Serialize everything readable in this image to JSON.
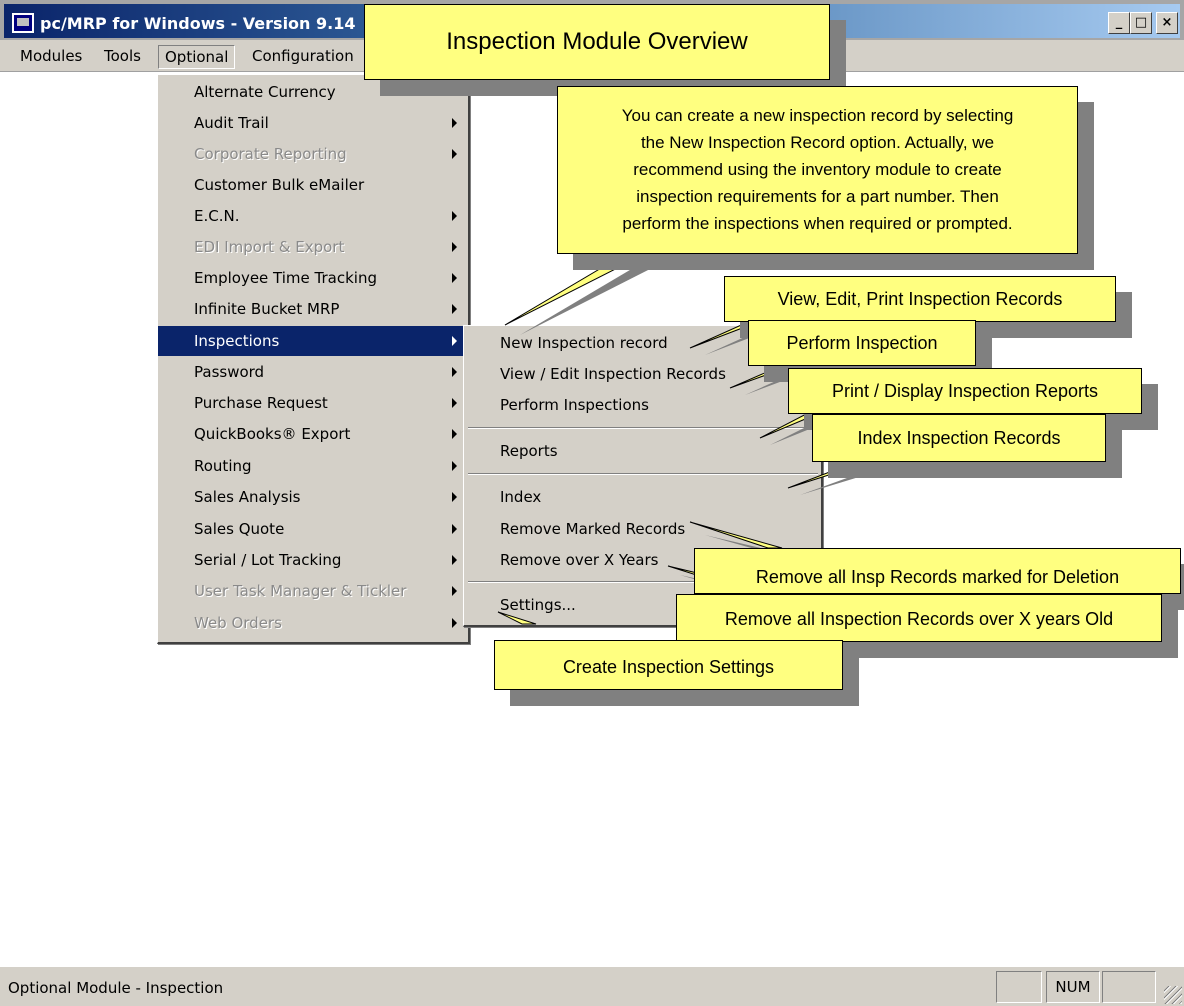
{
  "window": {
    "title": "pc/MRP for Windows - Version 9.14",
    "minimize_glyph": "_",
    "maximize_glyph": "□",
    "close_glyph": "×"
  },
  "menubar": {
    "items": [
      "Modules",
      "Tools",
      "Optional",
      "Configuration"
    ]
  },
  "optional_menu": {
    "items": [
      {
        "label": "Alternate Currency",
        "enabled": true,
        "submenu": false
      },
      {
        "label": "Audit Trail",
        "enabled": true,
        "submenu": true
      },
      {
        "label": "Corporate Reporting",
        "enabled": false,
        "submenu": true
      },
      {
        "label": "Customer Bulk eMailer",
        "enabled": true,
        "submenu": false
      },
      {
        "label": "E.C.N.",
        "enabled": true,
        "submenu": true
      },
      {
        "label": "EDI Import & Export",
        "enabled": false,
        "submenu": true
      },
      {
        "label": "Employee Time Tracking",
        "enabled": true,
        "submenu": true
      },
      {
        "label": "Infinite Bucket MRP",
        "enabled": true,
        "submenu": true
      },
      {
        "label": "Inspections",
        "enabled": true,
        "submenu": true,
        "highlighted": true
      },
      {
        "label": "Password",
        "enabled": true,
        "submenu": true
      },
      {
        "label": "Purchase Request",
        "enabled": true,
        "submenu": true
      },
      {
        "label": "QuickBooks® Export",
        "enabled": true,
        "submenu": true
      },
      {
        "label": "Routing",
        "enabled": true,
        "submenu": true
      },
      {
        "label": "Sales Analysis",
        "enabled": true,
        "submenu": true
      },
      {
        "label": "Sales Quote",
        "enabled": true,
        "submenu": true
      },
      {
        "label": "Serial / Lot Tracking",
        "enabled": true,
        "submenu": true
      },
      {
        "label": "User Task Manager & Tickler",
        "enabled": false,
        "submenu": true
      },
      {
        "label": "Web Orders",
        "enabled": false,
        "submenu": true
      }
    ]
  },
  "inspections_submenu": {
    "items": [
      {
        "label": "New Inspection record"
      },
      {
        "label": "View / Edit Inspection Records"
      },
      {
        "label": "Perform Inspections"
      },
      {
        "label": "Reports"
      },
      {
        "label": "Index"
      },
      {
        "label": "Remove Marked Records"
      },
      {
        "label": "Remove over X Years"
      },
      {
        "label": "Settings..."
      }
    ]
  },
  "callouts": {
    "overview_title": "Inspection Module Overview",
    "new_record_line1": "You can create a new inspection record by selecting",
    "new_record_line2": "the New Inspection Record option. Actually, we",
    "new_record_line3": "recommend using the inventory module to create",
    "new_record_line4": "inspection requirements for a part number.  Then",
    "new_record_line5": "perform the inspections when required or prompted.",
    "view_edit": "View, Edit, Print Inspection Records",
    "perform": "Perform Inspection",
    "reports": "Print / Display Inspection Reports",
    "index": "Index Inspection Records",
    "remove_marked": "Remove all Insp Records marked for Deletion",
    "remove_years": "Remove all Inspection Records over X years Old",
    "settings": "Create Inspection Settings"
  },
  "statusbar": {
    "text": "Optional Module - Inspection",
    "panel_num": "NUM"
  },
  "colors": {
    "callout_fill": "#ffff80",
    "menu_highlight": "#0a246a",
    "chrome": "#d4d0c8"
  }
}
